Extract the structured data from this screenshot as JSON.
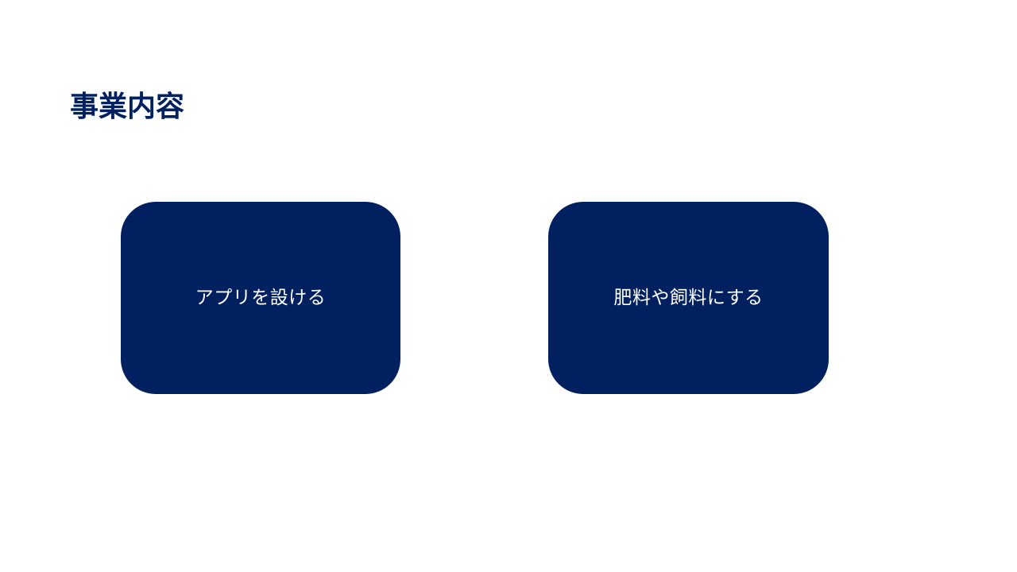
{
  "slide": {
    "title": "事業内容",
    "boxes": [
      {
        "label": "アプリを設ける"
      },
      {
        "label": "肥料や飼料にする"
      }
    ]
  },
  "colors": {
    "accent": "#002060",
    "box_text": "#ffffff",
    "background": "#ffffff"
  }
}
